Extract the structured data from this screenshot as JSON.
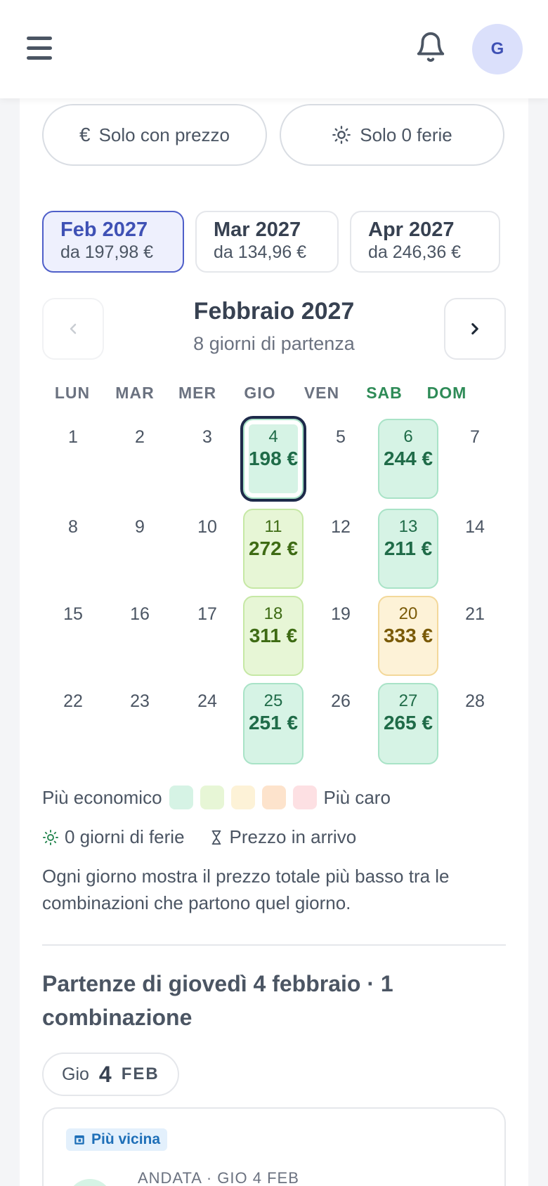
{
  "header": {
    "avatar_initial": "G"
  },
  "filters": [
    {
      "icon": "euro-icon",
      "label": "Solo con prezzo"
    },
    {
      "icon": "sun-icon",
      "label": "Solo 0 ferie"
    }
  ],
  "month_tabs": [
    {
      "name": "Feb 2027",
      "price": "da 197,98 €",
      "active": true
    },
    {
      "name": "Mar 2027",
      "price": "da 134,96 €",
      "active": false
    },
    {
      "name": "Apr 2027",
      "price": "da 246,36 €",
      "active": false
    }
  ],
  "calendar": {
    "title": "Febbraio 2027",
    "subtitle": "8 giorni di partenza",
    "weekdays": [
      "LUN",
      "MAR",
      "MER",
      "GIO",
      "VEN",
      "SAB",
      "DOM"
    ],
    "weeks": [
      [
        {
          "day": "1"
        },
        {
          "day": "2"
        },
        {
          "day": "3"
        },
        {
          "day": "4",
          "price": "198 €",
          "tier": 1,
          "selected": true
        },
        {
          "day": "5"
        },
        {
          "day": "6",
          "price": "244 €",
          "tier": 1
        },
        {
          "day": "7"
        }
      ],
      [
        {
          "day": "8"
        },
        {
          "day": "9"
        },
        {
          "day": "10"
        },
        {
          "day": "11",
          "price": "272 €",
          "tier": 2
        },
        {
          "day": "12"
        },
        {
          "day": "13",
          "price": "211 €",
          "tier": 1
        },
        {
          "day": "14"
        }
      ],
      [
        {
          "day": "15"
        },
        {
          "day": "16"
        },
        {
          "day": "17"
        },
        {
          "day": "18",
          "price": "311 €",
          "tier": 2
        },
        {
          "day": "19"
        },
        {
          "day": "20",
          "price": "333 €",
          "tier": 3
        },
        {
          "day": "21"
        }
      ],
      [
        {
          "day": "22"
        },
        {
          "day": "23"
        },
        {
          "day": "24"
        },
        {
          "day": "25",
          "price": "251 €",
          "tier": 1
        },
        {
          "day": "26"
        },
        {
          "day": "27",
          "price": "265 €",
          "tier": 1
        },
        {
          "day": "28"
        }
      ]
    ]
  },
  "legend": {
    "cheap_label": "Più economico",
    "expensive_label": "Più caro",
    "colors": [
      "#d6f3e5",
      "#e7f6d6",
      "#fdf2d7",
      "#fde3cc",
      "#fde0e3"
    ],
    "zero_days_label": "0 giorni di ferie",
    "pending_label": "Prezzo in arrivo",
    "note": "Ogni giorno mostra il prezzo totale più basso tra le combinazioni che partono quel giorno."
  },
  "departures": {
    "title": "Partenze di giovedì 4 febbraio · 1 combinazione",
    "chip": {
      "dow": "Gio",
      "day": "4",
      "month": "FEB"
    },
    "badge": "Più vicina",
    "leg_label": "ANDATA · GIO 4 FEB"
  }
}
